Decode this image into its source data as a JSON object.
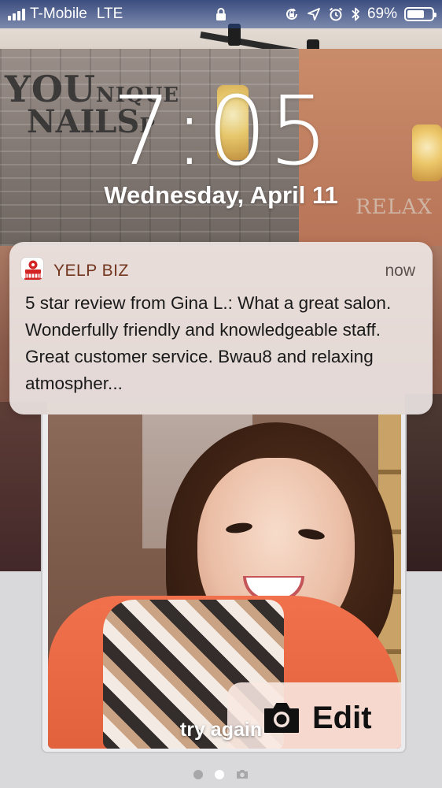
{
  "status_bar": {
    "carrier": "T-Mobile",
    "network": "LTE",
    "battery_percent": "69%",
    "battery_level": 0.69,
    "icons": [
      "signal-bars-icon",
      "lock-icon",
      "rotation-lock-icon",
      "location-arrow-icon",
      "alarm-clock-icon",
      "bluetooth-icon",
      "battery-icon"
    ]
  },
  "lock_screen": {
    "time": "7:05",
    "date": "Wednesday, April 11"
  },
  "wallpaper": {
    "salon_logo_line1": "YOU",
    "salon_logo_line1_small": "NIQUE",
    "salon_logo_line2": "NAILS",
    "salon_logo_line2_small": "P",
    "sign_text": "RELAX"
  },
  "notification": {
    "app_icon": "yelp-biz-icon",
    "app_name": "YELP BIZ",
    "time": "now",
    "message": "5 star review from Gina L.: What a great salon. Wonderfully friendly and knowledgeable staff. Great customer service. Bwau8 and relaxing atmospher..."
  },
  "camera_card": {
    "edit_label": "Edit",
    "edit_icon": "camera-icon",
    "try_again_label": "try again"
  },
  "page_indicator": {
    "pages": 3,
    "active_index": 1,
    "last_page_icon": "camera-icon"
  },
  "colors": {
    "app_name": "#73351e",
    "status_bar_tint": "#1c326e",
    "notification_bg": "#eee8e6"
  }
}
